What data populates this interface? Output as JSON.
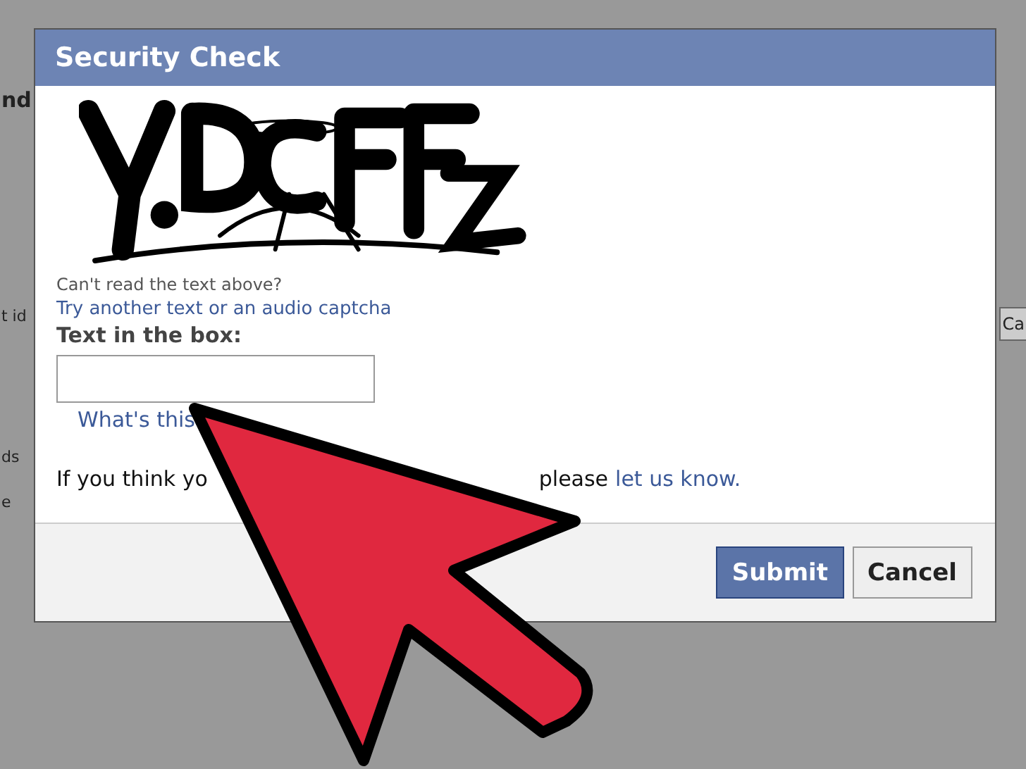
{
  "background_left_texts": [
    "nd",
    "t id",
    "ds",
    "e"
  ],
  "background_button": "Ca",
  "dialog": {
    "title": "Security Check",
    "captcha_hint": "Can't read the text above?",
    "captcha_link": "Try another text or an audio captcha",
    "field_label": "Text in the box:",
    "help_link": "What's this",
    "note_start": "If you think yo",
    "note_end": "please",
    "note_link": "let us know.",
    "buttons": [
      {
        "label": "Submit",
        "kind": "primary"
      },
      {
        "label": "Cancel",
        "kind": "secondary"
      }
    ]
  }
}
